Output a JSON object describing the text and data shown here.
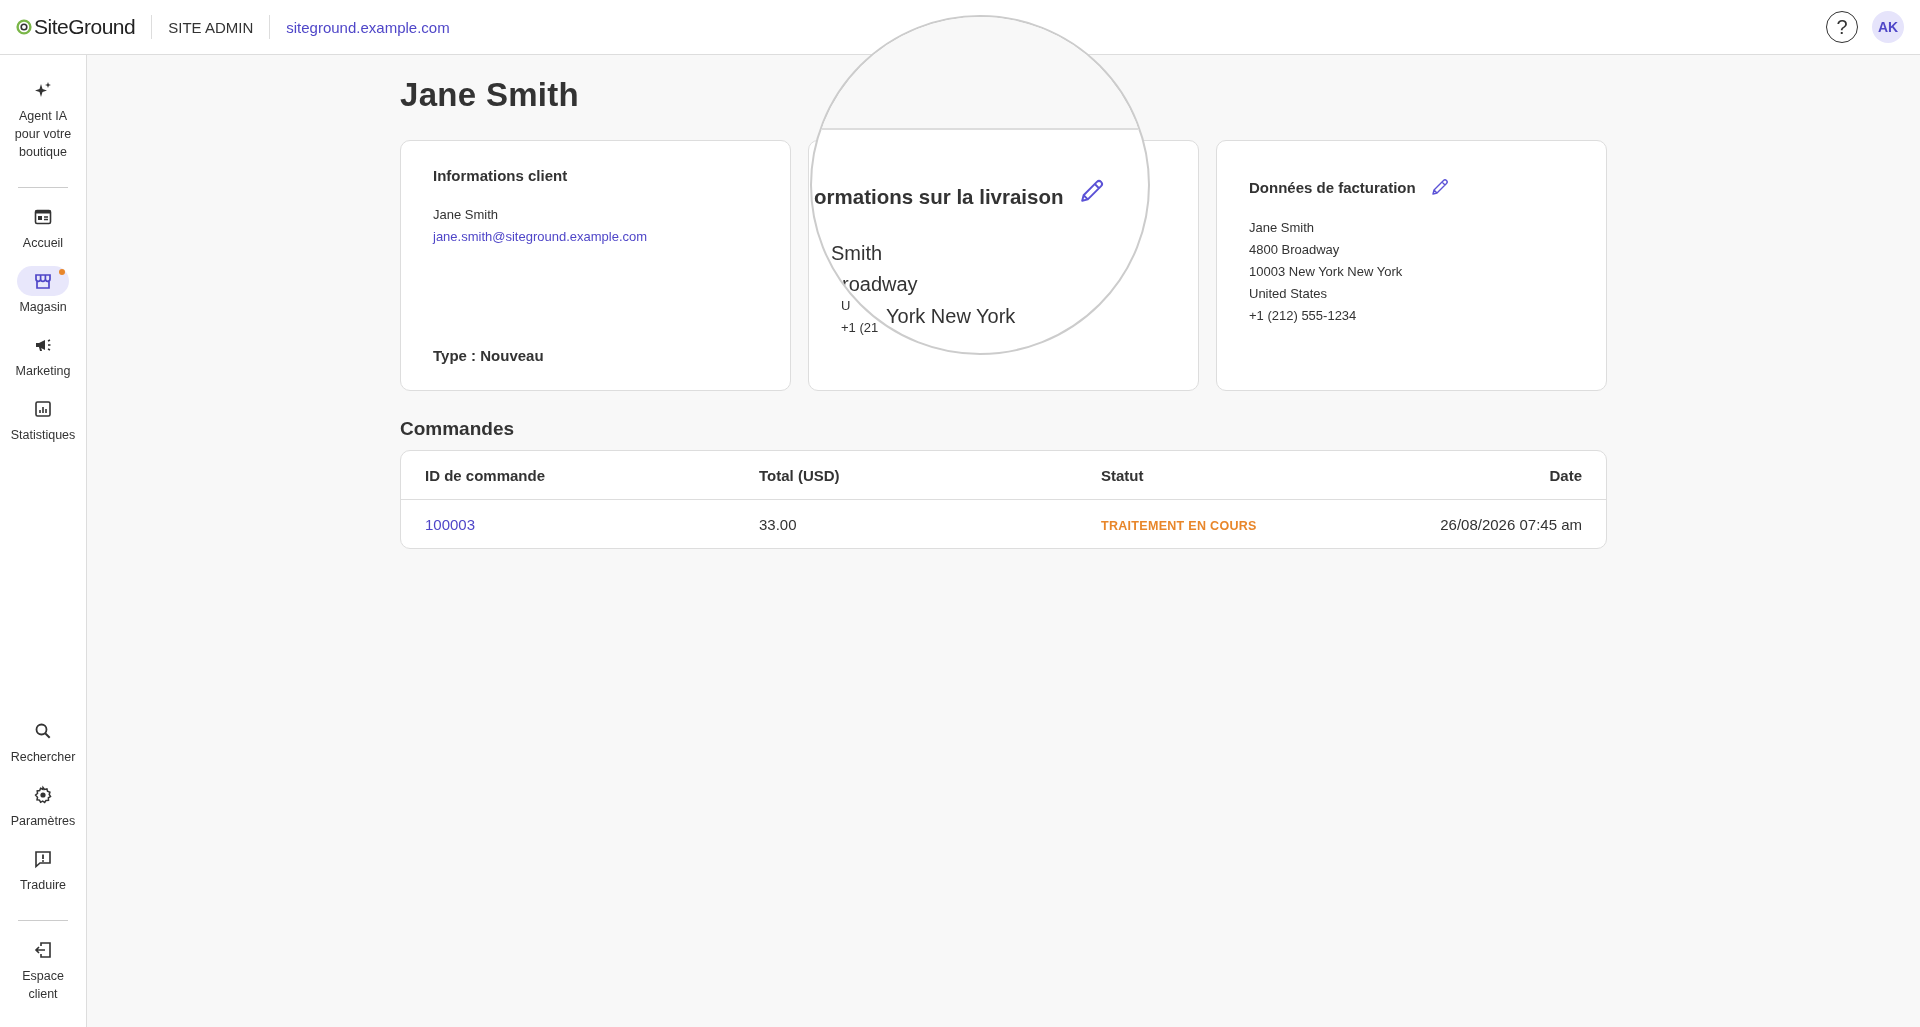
{
  "header": {
    "logo": "SiteGround",
    "section": "SITE ADMIN",
    "site": "siteground.example.com",
    "help": "?",
    "avatar": "AK"
  },
  "sidebar": {
    "top": [
      {
        "label": "Agent IA pour votre boutique",
        "selected": false,
        "badge": false
      }
    ],
    "items": [
      {
        "label": "Accueil",
        "selected": false,
        "badge": false
      },
      {
        "label": "Magasin",
        "selected": true,
        "badge": true
      },
      {
        "label": "Marketing",
        "selected": false,
        "badge": false
      },
      {
        "label": "Statistiques",
        "selected": false,
        "badge": false
      }
    ],
    "bottom": [
      {
        "label": "Rechercher",
        "selected": false,
        "badge": false
      },
      {
        "label": "Paramètres",
        "selected": false,
        "badge": false
      },
      {
        "label": "Traduire",
        "selected": false,
        "badge": false
      }
    ],
    "footer": [
      {
        "label": "Espace client",
        "selected": false,
        "badge": false
      }
    ]
  },
  "title": "Jane Smith",
  "customer_card": {
    "heading": "Informations client",
    "name": "Jane Smith",
    "email": "jane.smith@siteground.example.com",
    "type": "Type : Nouveau"
  },
  "shipping_card": {
    "lines": [
      "U",
      "+1 (21"
    ]
  },
  "billing_card": {
    "heading": "Données de facturation",
    "lines": [
      "Jane Smith",
      "4800 Broadway",
      "10003 New York New York",
      "United States",
      "+1 (212) 555-1234"
    ]
  },
  "magnifier": {
    "heading": "ormations sur la livraison",
    "lines": [
      "Smith",
      "roadway",
      "York New York"
    ]
  },
  "orders": {
    "heading": "Commandes",
    "columns": [
      "ID de commande",
      "Total (USD)",
      "Statut",
      "Date"
    ],
    "rows": [
      {
        "id": "100003",
        "total": "33.00",
        "status": "TRAITEMENT EN COURS",
        "date": "26/08/2026 07:45 am"
      }
    ]
  }
}
